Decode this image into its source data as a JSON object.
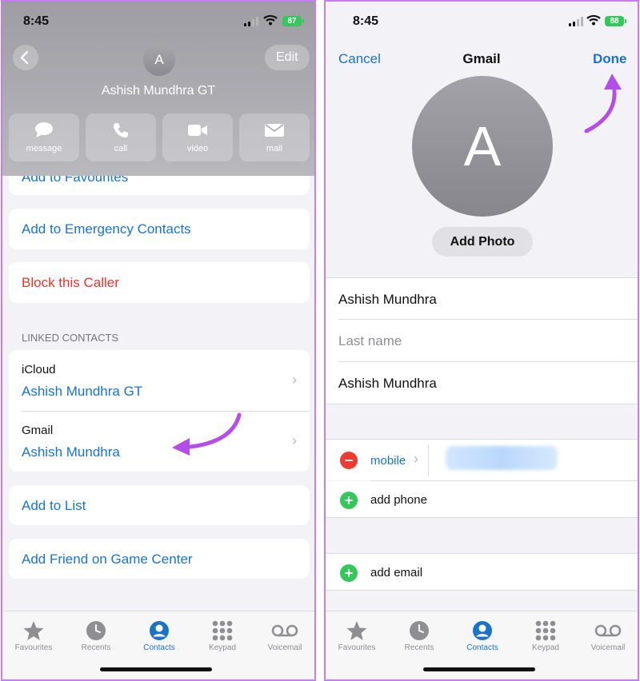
{
  "colors": {
    "accent": "#1a73c8",
    "destructive": "#e5352e",
    "annotation": "#b44ee8",
    "add": "#34c759",
    "remove": "#ee3b31"
  },
  "left": {
    "status": {
      "time": "8:45",
      "battery": "87"
    },
    "header": {
      "back_icon": "chevron-left-icon",
      "edit_label": "Edit",
      "avatar_letter": "A",
      "contact_name": "Ashish Mundhra GT"
    },
    "actions": [
      {
        "label": "message",
        "icon": "message-bubble-icon"
      },
      {
        "label": "call",
        "icon": "phone-icon"
      },
      {
        "label": "video",
        "icon": "video-camera-icon"
      },
      {
        "label": "mail",
        "icon": "envelope-icon"
      }
    ],
    "rows": {
      "favourites": "Add to Favourites",
      "emergency": "Add to Emergency Contacts",
      "block": "Block this Caller",
      "add_list": "Add to List",
      "game_center": "Add Friend on Game Center"
    },
    "linked": {
      "section_title": "LINKED CONTACTS",
      "items": [
        {
          "source": "iCloud",
          "name": "Ashish Mundhra GT"
        },
        {
          "source": "Gmail",
          "name": "Ashish Mundhra"
        }
      ]
    }
  },
  "right": {
    "status": {
      "time": "8:45",
      "battery": "88"
    },
    "nav": {
      "cancel": "Cancel",
      "title": "Gmail",
      "done": "Done"
    },
    "avatar_letter": "A",
    "add_photo": "Add Photo",
    "fields": {
      "first_name": "Ashish Mundhra",
      "last_name_placeholder": "Last name",
      "company": "Ashish Mundhra"
    },
    "phone": {
      "label": "mobile",
      "add_label": "add phone"
    },
    "email": {
      "add_label": "add email"
    }
  },
  "tabs": [
    {
      "label": "Favourites",
      "icon": "star-icon"
    },
    {
      "label": "Recents",
      "icon": "clock-icon"
    },
    {
      "label": "Contacts",
      "icon": "person-circle-icon",
      "active": true
    },
    {
      "label": "Keypad",
      "icon": "keypad-icon"
    },
    {
      "label": "Voicemail",
      "icon": "voicemail-icon"
    }
  ]
}
